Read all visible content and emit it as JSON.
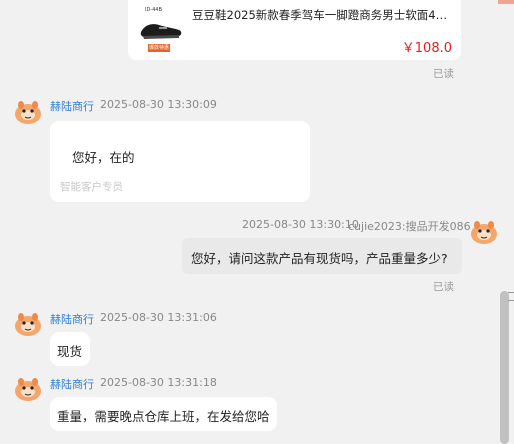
{
  "product": {
    "thumb_top_label": "ID-44B",
    "thumb_bottom_label": "爆款特惠",
    "title": "豆豆鞋2025新款春季驾车一脚蹬商务男士软面46休闲...",
    "price": "￥108.0"
  },
  "messages": [
    {
      "read_status": "已读"
    },
    {
      "sender": "赫陆商行",
      "time": "2025-08-30 13:30:09",
      "text": "您好，在的",
      "sub_label": "智能客户专员"
    },
    {
      "time": "2025-08-30 13:30:10",
      "sender": "cujie2023:搜品开发086",
      "text": "您好，请问这款产品有现货吗，产品重量多少?",
      "read_status": "已读"
    },
    {
      "sender": "赫陆商行",
      "time": "2025-08-30 13:31:06",
      "text": "现货"
    },
    {
      "sender": "赫陆商行",
      "time": "2025-08-30 13:31:18",
      "text": "重量，需要晚点仓库上班，在发给您哈"
    }
  ],
  "colors": {
    "shop_name": "#2a7fd4",
    "price": "#e02020",
    "avatar_bg": "#f5a66b"
  },
  "icons": {
    "avatar": "cartoon-mascot-avatar-icon"
  }
}
